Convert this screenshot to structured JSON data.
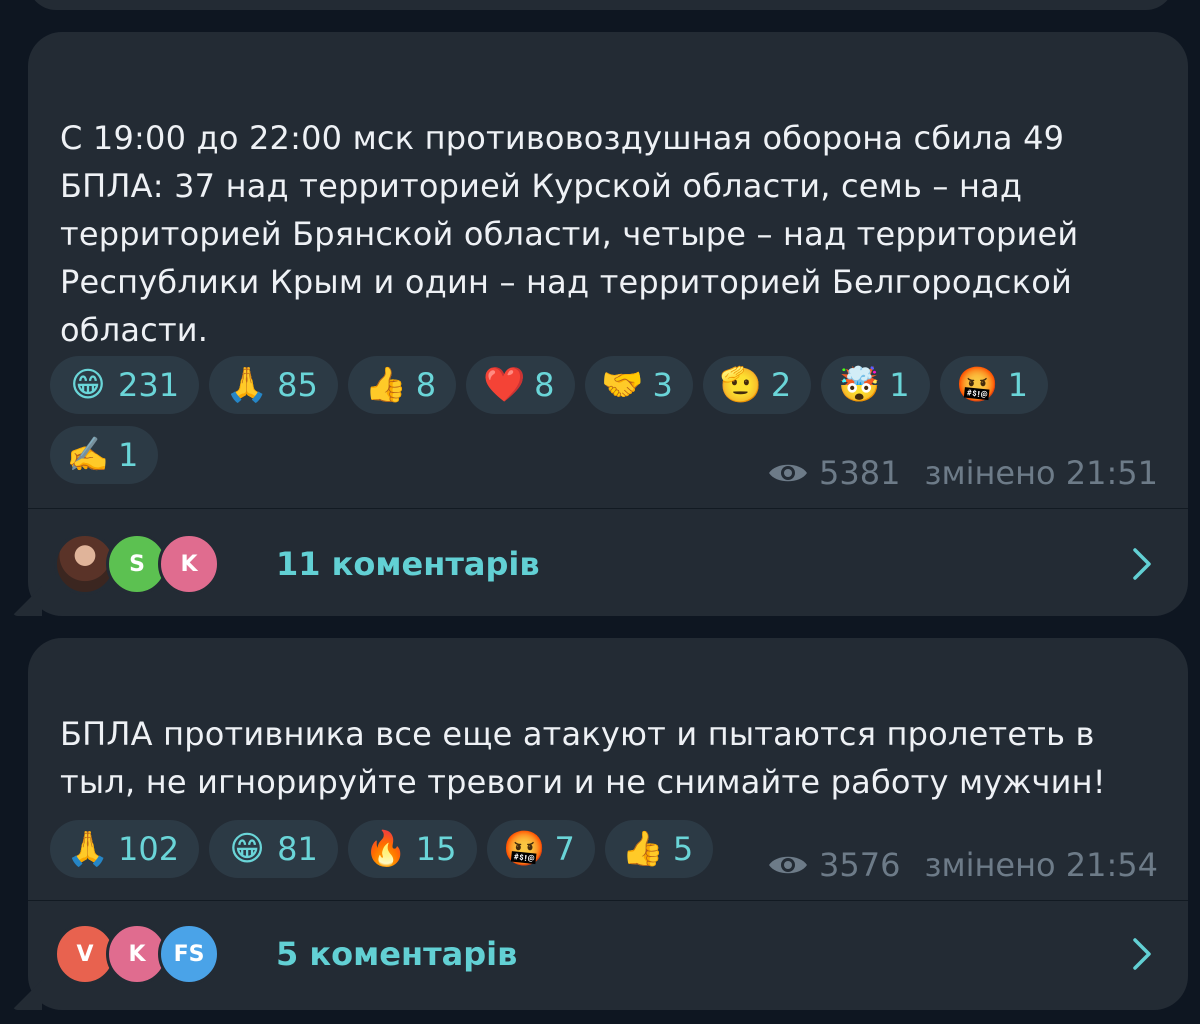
{
  "messages": [
    {
      "text": "С 19:00 до 22:00 мск противовоздушная оборона сбила 49 БПЛА: 37 над территорией Курской области, семь – над территорией Брянской области, четыре – над территорией Республики Крым и один – над территорией Белгородской области.",
      "reactions": [
        {
          "emoji": "😁",
          "count": "231"
        },
        {
          "emoji": "🙏",
          "count": "85"
        },
        {
          "emoji": "👍",
          "count": "8"
        },
        {
          "emoji": "❤️",
          "count": "8"
        },
        {
          "emoji": "🤝",
          "count": "3"
        },
        {
          "emoji": "🫡",
          "count": "2"
        },
        {
          "emoji": "🤯",
          "count": "1"
        },
        {
          "emoji": "🤬",
          "count": "1"
        },
        {
          "emoji": "✍️",
          "count": "1"
        }
      ],
      "views": "5381",
      "edited": "змінено 21:51",
      "comments_label": "11 коментарів",
      "avatars": [
        {
          "initial": "",
          "color": "#8a5a4a",
          "type": "photo"
        },
        {
          "initial": "S",
          "color": "#5cc151"
        },
        {
          "initial": "K",
          "color": "#e06c8f"
        }
      ]
    },
    {
      "text": "БПЛА противника все еще атакуют и пытаются пролететь в тыл, не игнорируйте тревоги и не снимайте работу мужчин!",
      "reactions": [
        {
          "emoji": "🙏",
          "count": "102"
        },
        {
          "emoji": "😁",
          "count": "81"
        },
        {
          "emoji": "🔥",
          "count": "15"
        },
        {
          "emoji": "🤬",
          "count": "7"
        },
        {
          "emoji": "👍",
          "count": "5"
        }
      ],
      "views": "3576",
      "edited": "змінено 21:54",
      "comments_label": "5 коментарів",
      "avatars": [
        {
          "initial": "V",
          "color": "#e8624f"
        },
        {
          "initial": "K",
          "color": "#e06c8f"
        },
        {
          "initial": "FS",
          "color": "#4aa3e8"
        }
      ]
    }
  ],
  "colors": {
    "background": "#0e1621",
    "bubble": "#232b34",
    "reaction_bg": "#2c3a45",
    "accent": "#62d0d4",
    "meta": "#6d7b88"
  },
  "icons": {
    "views": "eye-icon",
    "open": "chevron-right-icon"
  }
}
